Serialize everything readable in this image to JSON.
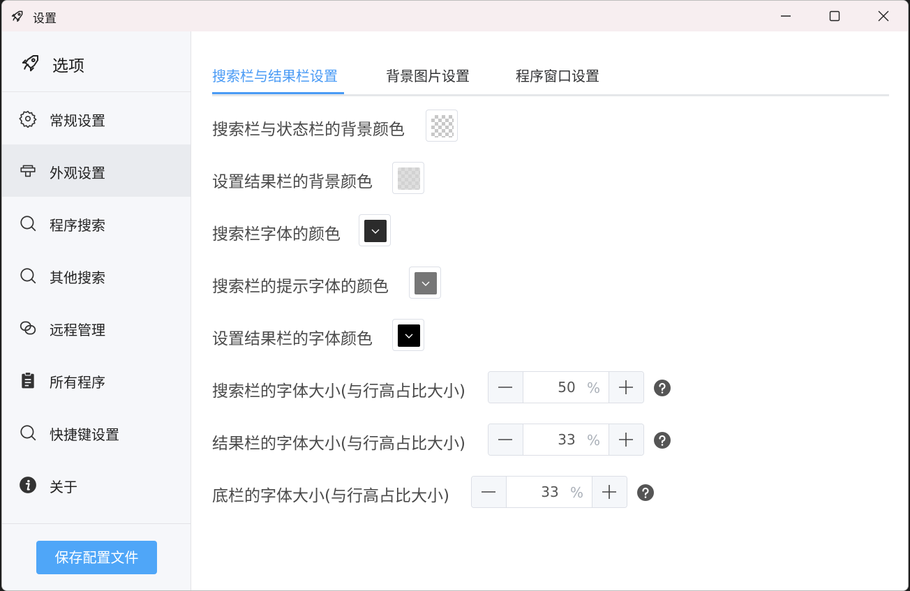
{
  "window": {
    "title": "设置"
  },
  "sidebar": {
    "header": "选项",
    "items": [
      {
        "label": "常规设置",
        "icon": "gear-icon"
      },
      {
        "label": "外观设置",
        "icon": "appearance-icon",
        "active": true
      },
      {
        "label": "程序搜索",
        "icon": "search-icon"
      },
      {
        "label": "其他搜索",
        "icon": "search-icon"
      },
      {
        "label": "远程管理",
        "icon": "link-icon"
      },
      {
        "label": "所有程序",
        "icon": "clipboard-icon"
      },
      {
        "label": "快捷键设置",
        "icon": "search-icon"
      },
      {
        "label": "关于",
        "icon": "info-icon"
      }
    ],
    "save_button": "保存配置文件"
  },
  "tabs": [
    {
      "label": "搜索栏与结果栏设置",
      "active": true
    },
    {
      "label": "背景图片设置"
    },
    {
      "label": "程序窗口设置"
    }
  ],
  "settings": {
    "color_rows": [
      {
        "label": "搜索栏与状态栏的背景颜色",
        "color": "transparent"
      },
      {
        "label": "设置结果栏的背景颜色",
        "color": "#dedede"
      },
      {
        "label": "搜索栏字体的颜色",
        "color": "#2b2b2b"
      },
      {
        "label": "搜索栏的提示字体的颜色",
        "color": "#767676"
      },
      {
        "label": "设置结果栏的字体颜色",
        "color": "#000000"
      }
    ],
    "size_rows": [
      {
        "label": "搜索栏的字体大小(与行高占比大小)",
        "value": "50",
        "suffix": "%"
      },
      {
        "label": "结果栏的字体大小(与行高占比大小)",
        "value": "33",
        "suffix": "%"
      },
      {
        "label": "底栏的字体大小(与行高占比大小)",
        "value": "33",
        "suffix": "%"
      }
    ]
  },
  "colors": {
    "accent": "#4a9bf5",
    "save_button": "#4fa6f8",
    "sidebar_bg": "#f6f7fa",
    "titlebar_bg": "#f7eef0"
  }
}
